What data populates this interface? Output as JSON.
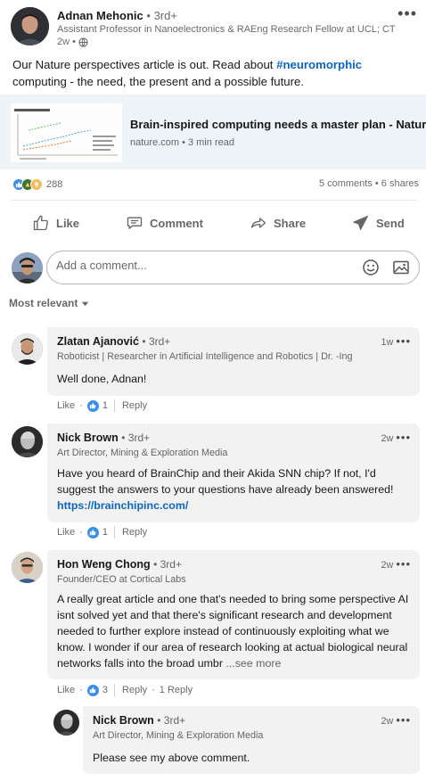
{
  "post": {
    "author": {
      "name": "Adnan Mehonic",
      "degree": "• 3rd+",
      "headline": "Assistant Professor in Nanoelectronics & RAEng Research Fellow at UCL; CTO...",
      "time": "2w •"
    },
    "text_before": "Our Nature perspectives article is out. Read about ",
    "hashtag": "#neuromorphic",
    "text_after": " computing - the need, the present and a possible future.",
    "link": {
      "title": "Brain-inspired computing needs a master plan - Nature",
      "meta": "nature.com • 3 min read"
    }
  },
  "social": {
    "reaction_count": "288",
    "comments_shares": "5 comments • 6 shares",
    "colors": {
      "like": "#378fe9",
      "celebrate": "#44712e",
      "insightful": "#f5bb5c"
    }
  },
  "actions": {
    "like": "Like",
    "comment": "Comment",
    "share": "Share",
    "send": "Send"
  },
  "comment_box": {
    "placeholder": "Add a comment..."
  },
  "sort": {
    "label": "Most relevant"
  },
  "comments": [
    {
      "name": "Zlatan Ajanović",
      "degree": "• 3rd+",
      "headline": "Roboticist | Researcher in Artificial Intelligence and Robotics | Dr. -Ing",
      "time": "1w",
      "text": "Well done, Adnan!",
      "like_label": "Like",
      "like_count": "1",
      "reply_label": "Reply"
    },
    {
      "name": "Nick Brown",
      "degree": "• 3rd+",
      "headline": "Art Director, Mining & Exploration Media",
      "time": "2w",
      "text": "Have you heard of BrainChip and their Akida SNN chip? If not, I'd suggest the answers to your questions have already been answered!",
      "link": "https://brainchipinc.com/",
      "like_label": "Like",
      "like_count": "1",
      "reply_label": "Reply"
    },
    {
      "name": "Hon Weng Chong",
      "degree": "• 3rd+",
      "headline": "Founder/CEO at Cortical Labs",
      "time": "2w",
      "text": "A really great article and one that's needed to bring some perspective AI isnt solved yet and that there's significant research and development needed to further explore instead of continuously exploiting what we know. I wonder if our area of research looking at actual biological neural networks falls into the broad umbr",
      "see_more": "...see more",
      "like_label": "Like",
      "like_count": "3",
      "reply_label": "Reply",
      "replies_label": "1 Reply"
    },
    {
      "name": "Nick Brown",
      "degree": "• 3rd+",
      "headline": "Art Director, Mining & Exploration Media",
      "time": "2w",
      "text": "Please see my above comment."
    }
  ],
  "menu_dots": "•••"
}
